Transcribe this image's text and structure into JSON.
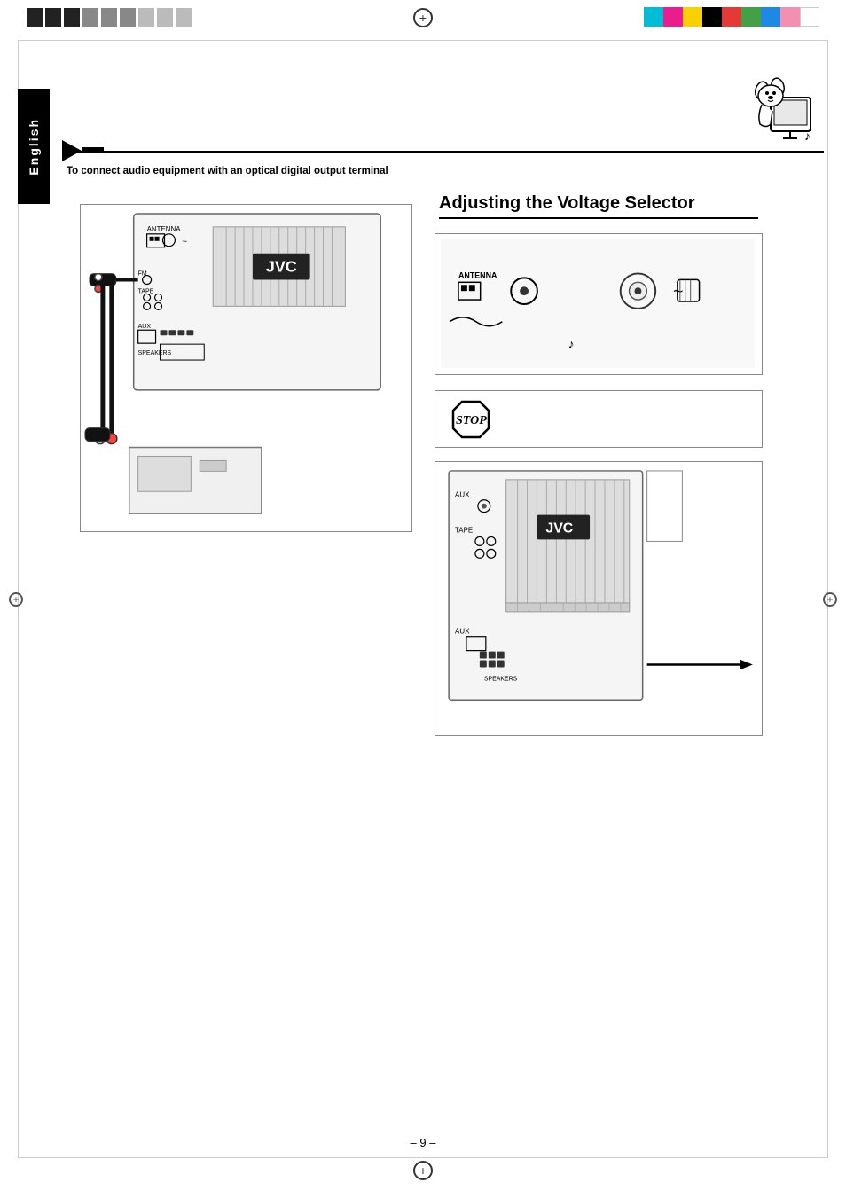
{
  "page": {
    "number": "– 9 –",
    "language_tab": "English",
    "left_subtitle": "To connect audio equipment with an optical digital output terminal",
    "right_title": "Adjusting the Voltage Selector",
    "registration_symbol": "+",
    "stop_text": "STOP"
  },
  "color_blocks": [
    "cyan",
    "magenta",
    "yellow",
    "black",
    "red",
    "green",
    "blue",
    "pink",
    "white"
  ],
  "registration_blocks_left": [
    "black",
    "black",
    "black",
    "gray",
    "gray",
    "gray",
    "lgray",
    "lgray",
    "lgray"
  ]
}
